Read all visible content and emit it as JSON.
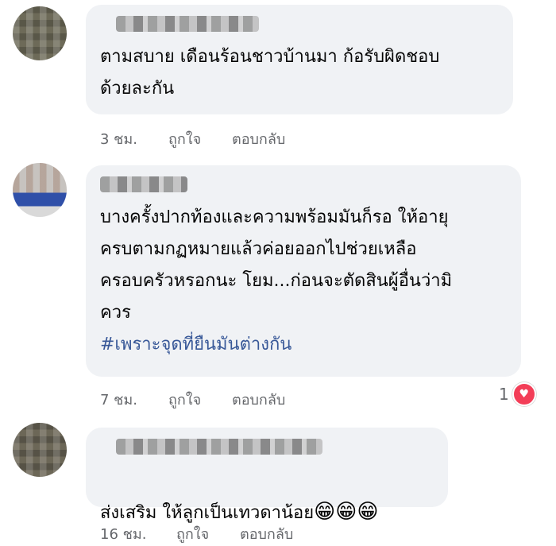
{
  "comments": [
    {
      "text": "ตามสบาย เดือนร้อนชาวบ้านมา ก้อรับผิดชอบ\nด้วยละกัน",
      "time": "3 ชม.",
      "like": "ถูกใจ",
      "reply": "ตอบกลับ"
    },
    {
      "text": "บางครั้งปากท้องและความพร้อมมันก็รอ ให้อายุ\nครบตามกฏหมายแล้วค่อยออกไปช่วยเหลือ\nครอบครัวหรอกนะ โยม...ก่อนจะตัดสินผู้อื่นว่ามิ\nควร",
      "hashtag": "#เพราะจุดที่ยืนมันต่างกัน",
      "time": "7 ชม.",
      "like": "ถูกใจ",
      "reply": "ตอบกลับ",
      "reaction_count": "1",
      "reaction_icon": "heart-icon"
    },
    {
      "text": "ส่งเสริม ให้ลูกเป็นเทวดาน้อย",
      "emojis": "😁😁😁",
      "time": "16 ชม.",
      "like": "ถูกใจ",
      "reply": "ตอบกลับ"
    }
  ],
  "colors": {
    "bubble": "#f0f2f5",
    "meta": "#65676b",
    "hashtag": "#385898",
    "heart": "#f33e58"
  }
}
